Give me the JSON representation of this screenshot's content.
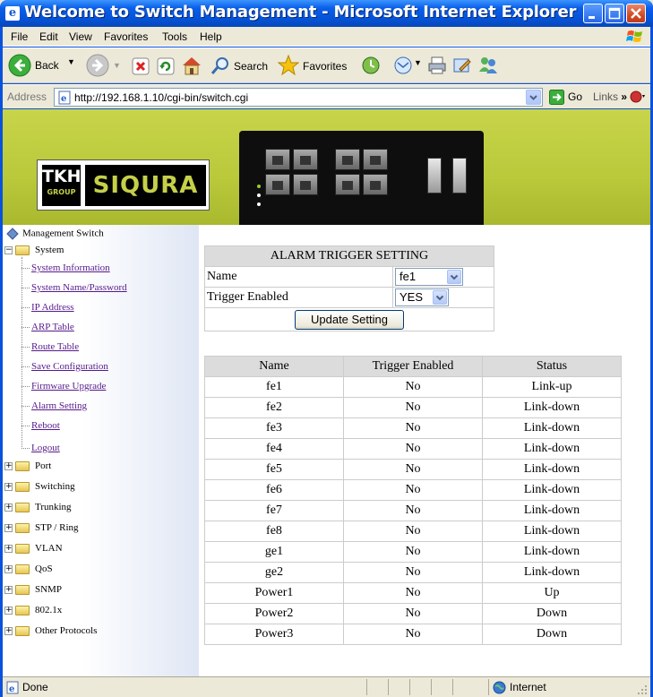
{
  "window": {
    "title": "Welcome to Switch Management - Microsoft Internet Explorer"
  },
  "menu": [
    "File",
    "Edit",
    "View",
    "Favorites",
    "Tools",
    "Help"
  ],
  "toolbar": {
    "back": "Back",
    "search": "Search",
    "favorites": "Favorites"
  },
  "address": {
    "label": "Address",
    "url": "http://192.168.1.10/cgi-bin/switch.cgi",
    "go": "Go",
    "links": "Links"
  },
  "banner": {
    "logo_th": "TKH",
    "logo_group": "GROUP",
    "logo_brand": "SIQURA"
  },
  "sidebar": {
    "root": "Management Switch",
    "system": "System",
    "system_items": [
      "System Information",
      "System Name/Password",
      "IP Address",
      "ARP Table",
      "Route Table",
      "Save Configuration",
      "Firmware Upgrade",
      "Alarm Setting",
      "Reboot",
      "Logout"
    ],
    "folders": [
      "Port",
      "Switching",
      "Trunking",
      "STP / Ring",
      "VLAN",
      "QoS",
      "SNMP",
      "802.1x",
      "Other Protocols"
    ]
  },
  "alarm_form": {
    "title": "ALARM TRIGGER SETTING",
    "name_label": "Name",
    "name_value": "fe1",
    "trigger_label": "Trigger Enabled",
    "trigger_value": "YES",
    "update_button": "Update Setting"
  },
  "status_table": {
    "headers": [
      "Name",
      "Trigger Enabled",
      "Status"
    ],
    "rows": [
      [
        "fe1",
        "No",
        "Link-up"
      ],
      [
        "fe2",
        "No",
        "Link-down"
      ],
      [
        "fe3",
        "No",
        "Link-down"
      ],
      [
        "fe4",
        "No",
        "Link-down"
      ],
      [
        "fe5",
        "No",
        "Link-down"
      ],
      [
        "fe6",
        "No",
        "Link-down"
      ],
      [
        "fe7",
        "No",
        "Link-down"
      ],
      [
        "fe8",
        "No",
        "Link-down"
      ],
      [
        "ge1",
        "No",
        "Link-down"
      ],
      [
        "ge2",
        "No",
        "Link-down"
      ],
      [
        "Power1",
        "No",
        "Up"
      ],
      [
        "Power2",
        "No",
        "Down"
      ],
      [
        "Power3",
        "No",
        "Down"
      ]
    ]
  },
  "statusbar": {
    "left": "Done",
    "zone": "Internet"
  },
  "colors": {
    "titlebar": "#0553d8",
    "banner": "#b9c93a",
    "visited_link": "#551a8b"
  }
}
